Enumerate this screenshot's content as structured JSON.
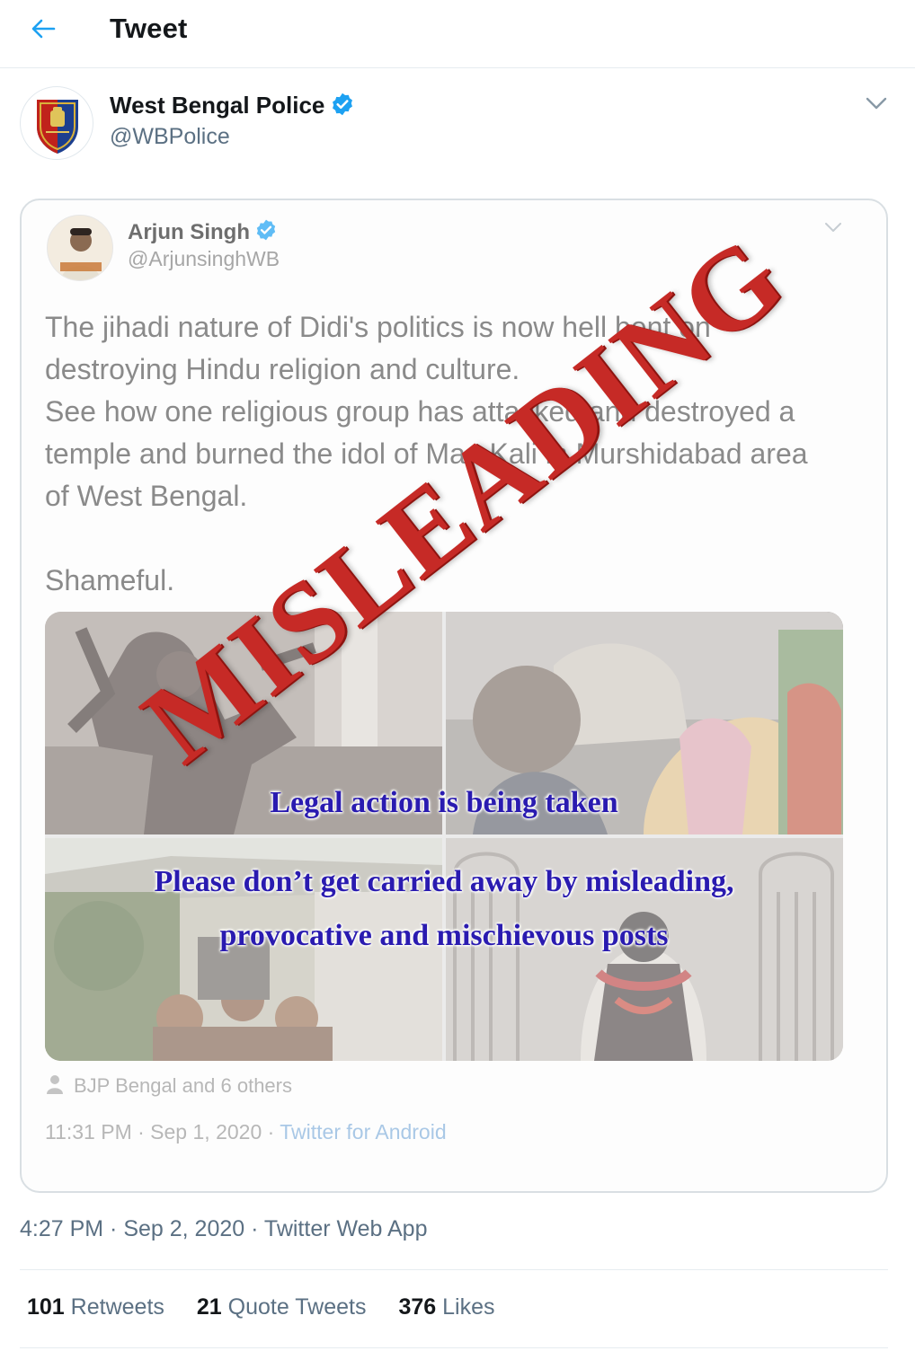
{
  "header": {
    "title": "Tweet",
    "back_icon": "arrow-left-icon"
  },
  "tweet": {
    "author_name": "West Bengal Police",
    "author_handle": "@WBPolice",
    "timestamp": "4:27 PM · Sep 2, 2020 · Twitter Web App",
    "stats": {
      "retweets_count": "101",
      "retweets_label": "Retweets",
      "quotes_count": "21",
      "quotes_label": "Quote Tweets",
      "likes_count": "376",
      "likes_label": "Likes"
    }
  },
  "embedded": {
    "author_name": "Arjun Singh",
    "author_handle": "@ArjunsinghWB",
    "text": "The jihadi nature of Didi's politics is now hell bent on destroying Hindu religion and culture.\nSee how one religious group has attacked and destroyed a temple and burned the idol of Maa Kali in Murshidabad area of West Bengal.\n\nShameful.",
    "photo_caption_1": "Legal action is being taken",
    "photo_caption_2": "Please don’t get carried away by misleading,",
    "photo_caption_3": "provocative and mischievous posts",
    "likers": "BJP Bengal and 6 others",
    "meta_time": "11:31 PM · Sep 1, 2020 · ",
    "meta_source": "Twitter for Android",
    "stamp": "MISLEADING"
  },
  "colors": {
    "accent": "#1da1f2",
    "stamp": "#c62a26",
    "caption": "#2a1bb0",
    "muted": "#5b7083"
  }
}
